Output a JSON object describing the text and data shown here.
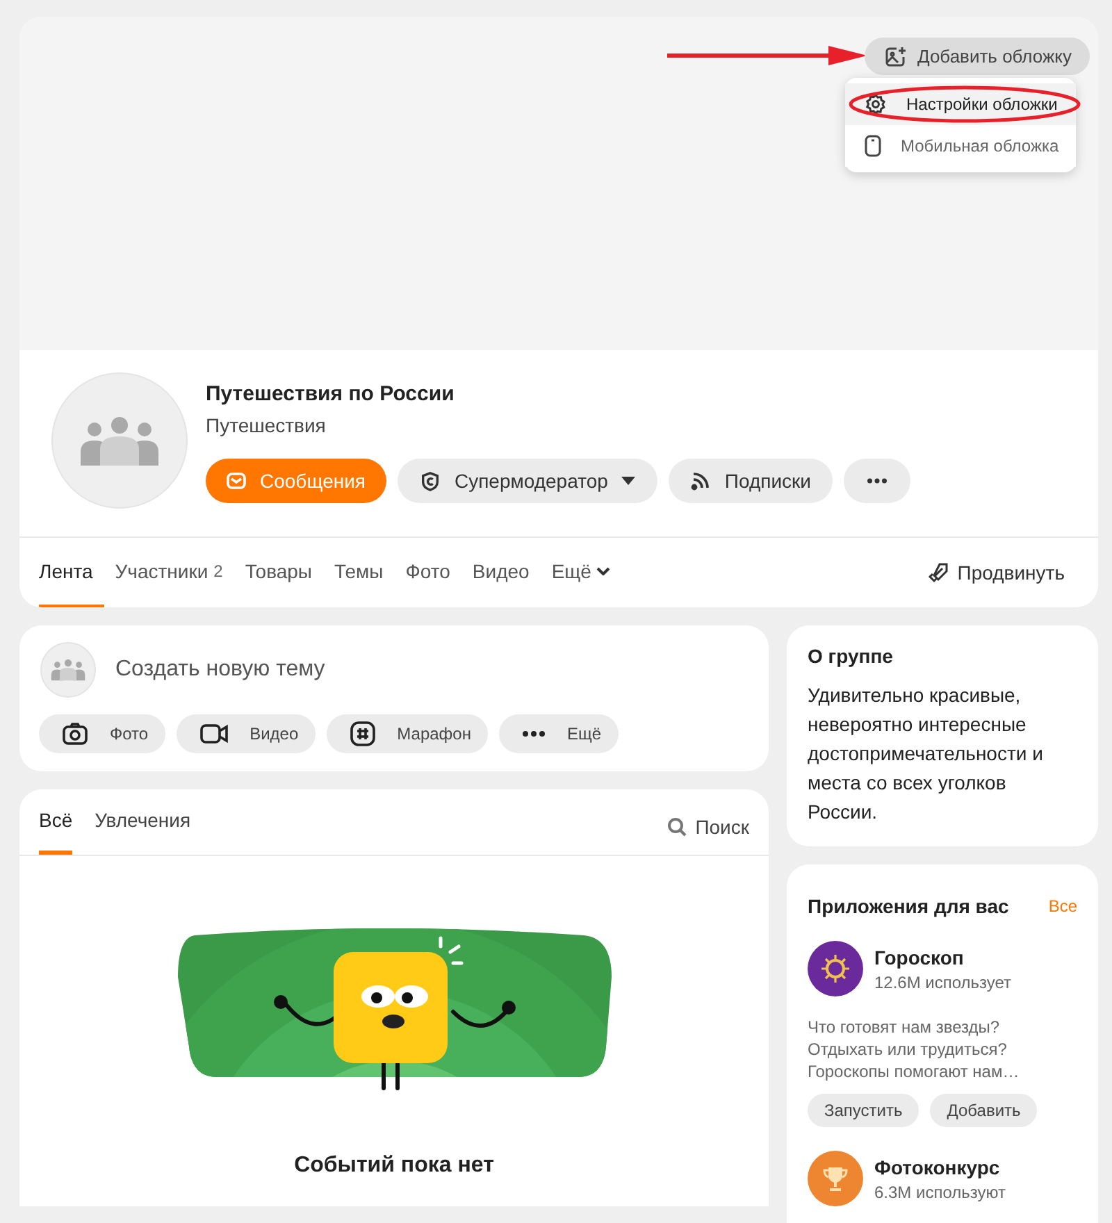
{
  "cover": {
    "add_button": "Добавить обложку",
    "menu": [
      {
        "label": "Настройки обложки",
        "kind": "gear",
        "selected": true
      },
      {
        "label": "Мобильная обложка",
        "kind": "phone",
        "selected": false
      }
    ]
  },
  "group": {
    "name": "Путешествия по России",
    "category": "Путешествия",
    "buttons": [
      {
        "kind": "primary",
        "label": "Сообщения"
      },
      {
        "kind": "dropdown",
        "label": "Супермодератор"
      },
      {
        "kind": "plain",
        "label": "Подписки"
      },
      {
        "kind": "more"
      }
    ]
  },
  "tabs": [
    {
      "label": "Лента",
      "selected": true
    },
    {
      "label": "Участники",
      "count": "2",
      "selected": false
    },
    {
      "label": "Товары",
      "selected": false
    },
    {
      "label": "Темы",
      "selected": false
    },
    {
      "label": "Фото",
      "selected": false
    },
    {
      "label": "Видео",
      "selected": false
    },
    {
      "label": "Ещё",
      "selected": false,
      "dropdown": true
    }
  ],
  "promote": "Продвинуть",
  "composer": {
    "placeholder": "Создать новую тему",
    "actions": [
      {
        "kind": "camera",
        "label": "Фото"
      },
      {
        "kind": "video",
        "label": "Видео"
      },
      {
        "kind": "hash",
        "label": "Марафон"
      },
      {
        "kind": "dots",
        "label": "Ещё"
      }
    ]
  },
  "feed": {
    "tabs": [
      {
        "label": "Всё",
        "selected": true
      },
      {
        "label": "Увлечения",
        "selected": false
      }
    ],
    "search": "Поиск",
    "empty": "Событий пока нет"
  },
  "about": {
    "title": "О группе",
    "text": "Удивительно красивые, невероятно интересные достопримечательности и места со всех уголков России."
  },
  "apps": {
    "title": "Приложения для вас",
    "all_link": "Все",
    "items": [
      {
        "name": "Гороскоп",
        "users": "12.6M использует",
        "color": "#6b2a9c",
        "description": "Что готовят нам звезды? Отдыхать или трудиться? Гороскопы помогают нам…",
        "buttons": [
          "Запустить",
          "Добавить"
        ]
      },
      {
        "name": "Фотоконкурс",
        "users": "6.3M используют",
        "color": "#ee8531"
      }
    ]
  }
}
